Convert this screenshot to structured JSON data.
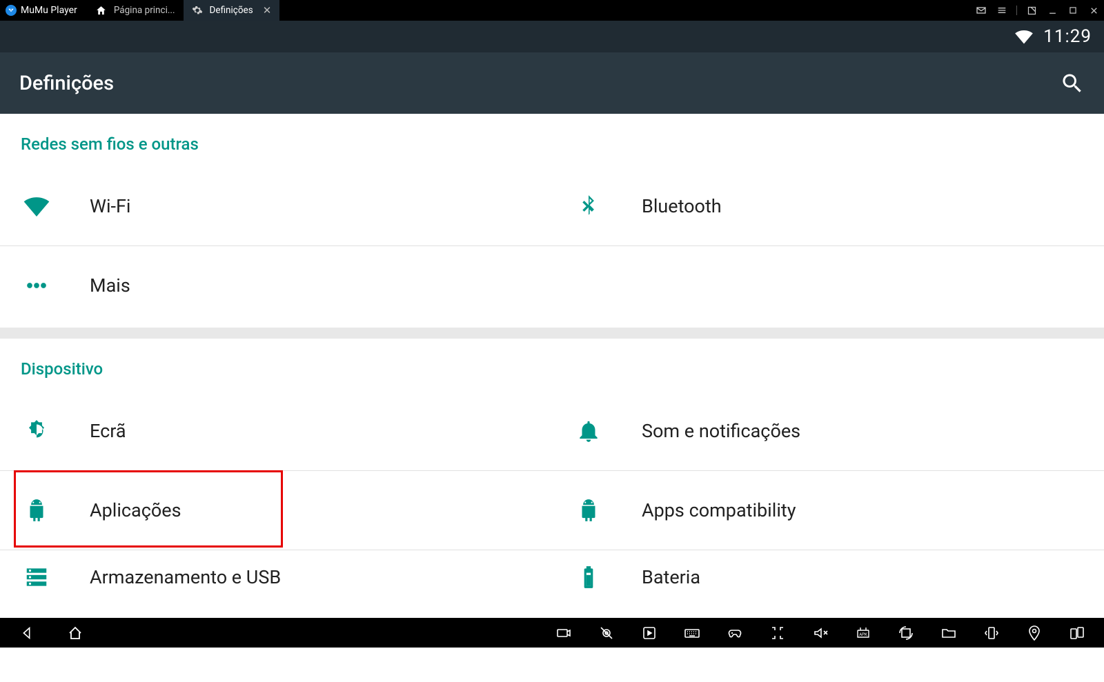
{
  "emulator": {
    "app_name": "MuMu Player",
    "tab_home": "Página princi...",
    "tab_active": "Definições"
  },
  "status": {
    "time": "11:29"
  },
  "actionbar": {
    "title": "Definições"
  },
  "sections": {
    "networks": {
      "header": "Redes sem fios e outras",
      "wifi": "Wi-Fi",
      "bluetooth": "Bluetooth",
      "more": "Mais"
    },
    "device": {
      "header": "Dispositivo",
      "display": "Ecrã",
      "sound": "Som e notificações",
      "apps": "Aplicações",
      "apps_compat": "Apps compatibility",
      "storage": "Armazenamento e USB",
      "battery": "Bateria"
    }
  },
  "colors": {
    "accent": "#009688",
    "highlight": "#e60000"
  }
}
